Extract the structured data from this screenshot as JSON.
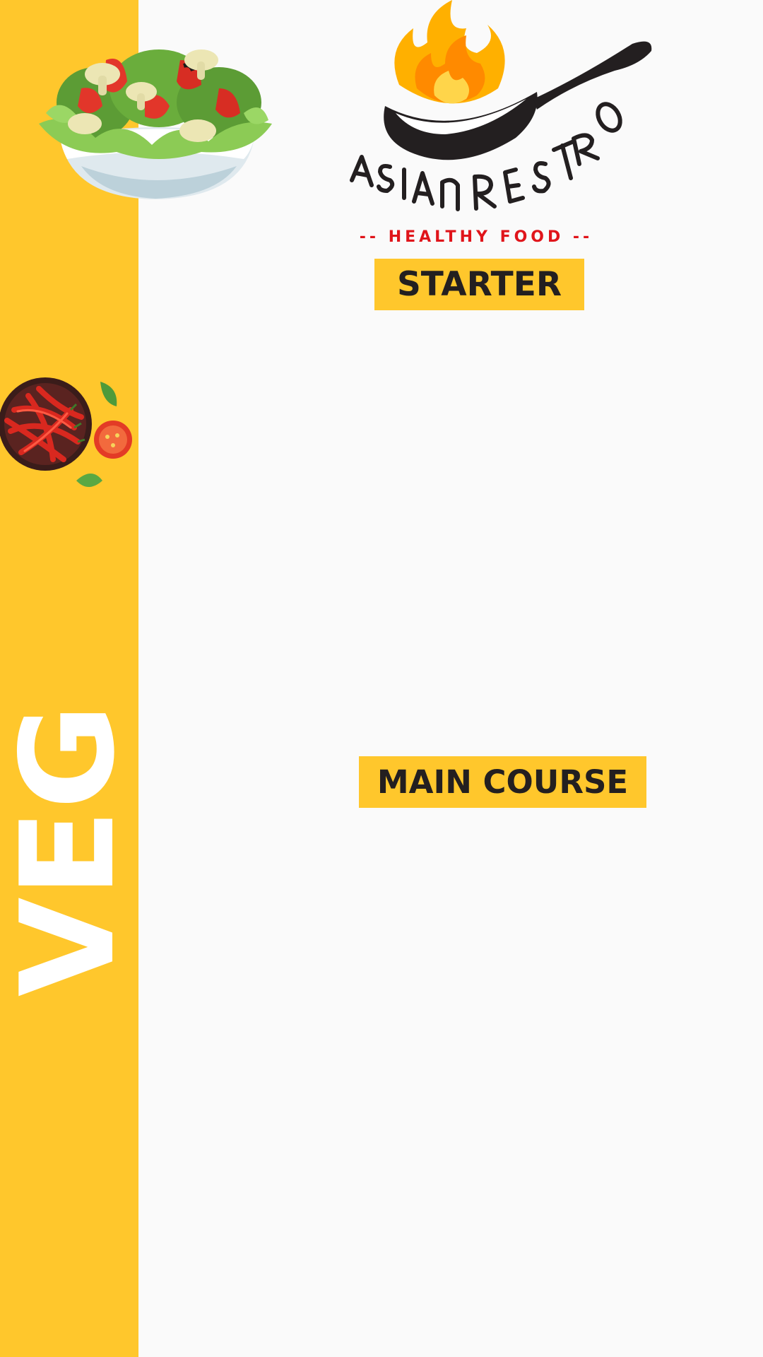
{
  "brand": {
    "name": "ASIAN RESTRO",
    "tagline": "-- HEALTHY FOOD --"
  },
  "sidebar": {
    "label": "VEG",
    "illustrations": [
      "salad-bowl-icon",
      "chili-bowl-icon"
    ]
  },
  "sections": {
    "starter": "STARTER",
    "main_course": "MAIN COURSE"
  },
  "colors": {
    "accent_yellow": "#ffc72c",
    "tagline_red": "#e0151b",
    "text_dark": "#231f20",
    "background": "#fafafa"
  }
}
